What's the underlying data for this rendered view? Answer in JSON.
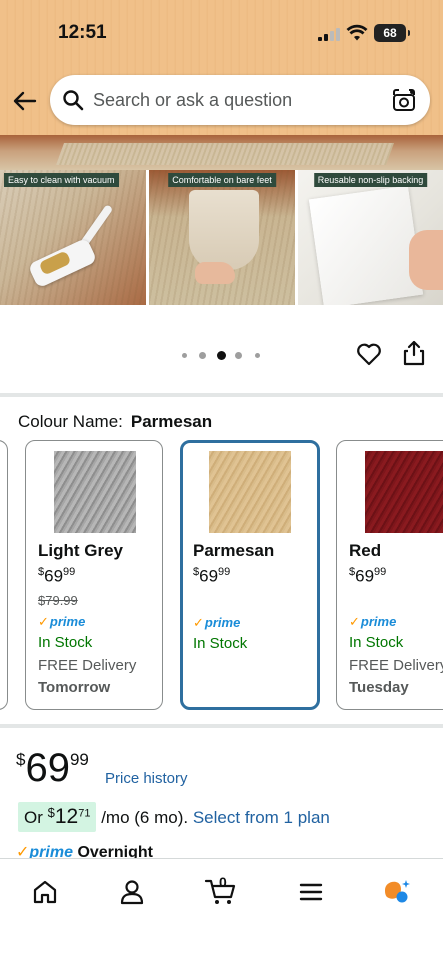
{
  "status_bar": {
    "time": "12:51",
    "battery": "68"
  },
  "search": {
    "placeholder": "Search or ask a question"
  },
  "carousel": {
    "image_labels": [
      "Easy to clean with vacuum",
      "Comfortable on bare feet",
      "Reusable non-slip backing"
    ],
    "dot_count": 5,
    "active_index": 2
  },
  "colour": {
    "label": "Colour Name:",
    "selected": "Parmesan",
    "options": [
      {
        "name": "Light Grey",
        "currency": "$",
        "price_whole": "69",
        "price_fraction": "99",
        "was_price": "$79.99",
        "prime": "prime",
        "stock": "In Stock",
        "delivery": "FREE Delivery",
        "delivery_day": "Tomorrow",
        "swatch_color": "#a3a3a3"
      },
      {
        "name": "Parmesan",
        "currency": "$",
        "price_whole": "69",
        "price_fraction": "99",
        "prime": "prime",
        "stock": "In Stock",
        "swatch_color": "#d9bc8a"
      },
      {
        "name": "Red",
        "currency": "$",
        "price_whole": "69",
        "price_fraction": "99",
        "prime": "prime",
        "stock": "In Stock",
        "delivery": "FREE Delivery",
        "delivery_day": "Tuesday",
        "swatch_color": "#7e161b"
      }
    ]
  },
  "price": {
    "currency": "$",
    "whole": "69",
    "fraction": "99",
    "history_link": "Price history"
  },
  "installment": {
    "prefix": "Or",
    "currency": "$",
    "whole": "12",
    "fraction": "71",
    "term": "/mo (6 mo).",
    "plan_link": "Select from 1 plan"
  },
  "shipping": {
    "prime": "prime",
    "speed": "Overnight"
  },
  "nav": {
    "items": [
      "home-icon",
      "account-icon",
      "cart-icon",
      "menu-icon",
      "rufus-icon"
    ],
    "cart_count": "0"
  },
  "colors": {
    "header_bg": "#f0c089",
    "link": "#2162a1",
    "in_stock": "#007600",
    "prime_blue": "#1a8cd8",
    "selected_border": "#2f6f9f",
    "installment_bg": "#d3f4e2"
  }
}
